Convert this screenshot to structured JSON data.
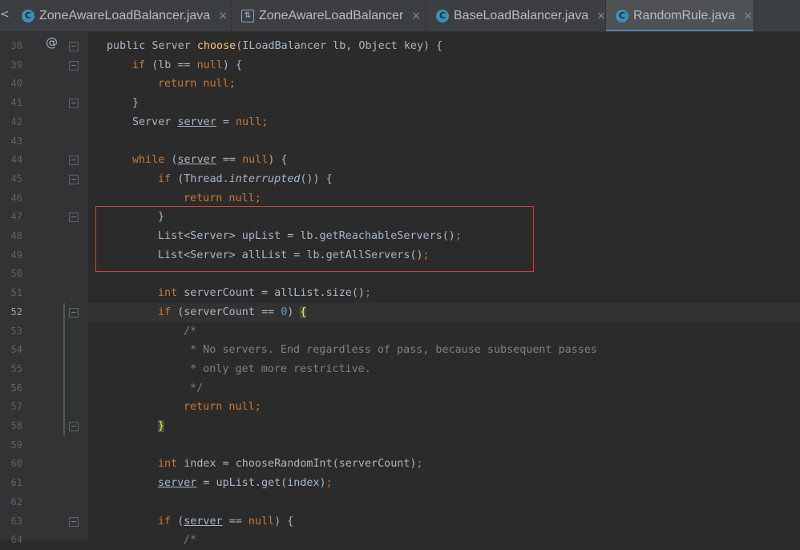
{
  "tabs": [
    {
      "label": "ZoneAwareLoadBalancer.java",
      "icon": "class-icon",
      "active": false
    },
    {
      "label": "ZoneAwareLoadBalancer",
      "icon": "hierarchy-icon",
      "active": false
    },
    {
      "label": "BaseLoadBalancer.java",
      "icon": "class-icon",
      "active": false
    },
    {
      "label": "RandomRule.java",
      "icon": "class-icon",
      "active": true
    }
  ],
  "tab_close_glyph": "×",
  "tab_scroll_glyph": "<",
  "override_marker": "@",
  "current_line": 52,
  "colors": {
    "background": "#2b2b2b",
    "keyword": "#cc7832",
    "method": "#ffc66d",
    "number": "#6897bb",
    "comment": "#808080",
    "highlight_box": "#e03c31"
  },
  "lines": [
    {
      "n": "38",
      "tokens": [
        [
          "",
          "public "
        ],
        [
          "",
          "Server "
        ],
        [
          "fn",
          "choose"
        ],
        [
          "",
          "(ILoadBalancer lb, Object key) {"
        ]
      ]
    },
    {
      "n": "39",
      "tokens": [
        [
          "kw",
          "if "
        ],
        [
          "",
          "(lb == "
        ],
        [
          "kw",
          "null"
        ],
        [
          "",
          ") {"
        ]
      ]
    },
    {
      "n": "40",
      "tokens": [
        [
          "kw",
          "return null"
        ],
        [
          "kw",
          ";"
        ]
      ]
    },
    {
      "n": "41",
      "tokens": [
        [
          "",
          "}"
        ]
      ]
    },
    {
      "n": "42",
      "tokens": [
        [
          "",
          "Server "
        ],
        [
          "ul",
          "server"
        ],
        [
          "",
          " = "
        ],
        [
          "kw",
          "null"
        ],
        [
          "kw",
          ";"
        ]
      ]
    },
    {
      "n": "43",
      "tokens": []
    },
    {
      "n": "44",
      "tokens": [
        [
          "kw",
          "while "
        ],
        [
          "",
          "("
        ],
        [
          "ul",
          "server"
        ],
        [
          "",
          " == "
        ],
        [
          "kw",
          "null"
        ],
        [
          "",
          ") {"
        ]
      ]
    },
    {
      "n": "45",
      "tokens": [
        [
          "kw",
          "if "
        ],
        [
          "",
          "(Thread."
        ],
        [
          "it",
          "interrupted"
        ],
        [
          "",
          "()) {"
        ]
      ]
    },
    {
      "n": "46",
      "tokens": [
        [
          "kw",
          "return null"
        ],
        [
          "kw",
          ";"
        ]
      ]
    },
    {
      "n": "47",
      "tokens": [
        [
          "",
          "}"
        ]
      ]
    },
    {
      "n": "48",
      "tokens": [
        [
          "",
          "List<Server> upList = lb.getReachableServers()"
        ],
        [
          "kw",
          ";"
        ]
      ]
    },
    {
      "n": "49",
      "tokens": [
        [
          "",
          "List<Server> allList = lb.getAllServers()"
        ],
        [
          "kw",
          ";"
        ]
      ]
    },
    {
      "n": "50",
      "tokens": []
    },
    {
      "n": "51",
      "tokens": [
        [
          "kw",
          "int "
        ],
        [
          "",
          "serverCount = allList.size()"
        ],
        [
          "kw",
          ";"
        ]
      ]
    },
    {
      "n": "52",
      "tokens": [
        [
          "kw",
          "if "
        ],
        [
          "",
          "(serverCount == "
        ],
        [
          "num",
          "0"
        ],
        [
          "",
          ") "
        ],
        [
          "bm",
          "{"
        ]
      ]
    },
    {
      "n": "53",
      "tokens": [
        [
          "cm",
          "/*"
        ]
      ]
    },
    {
      "n": "54",
      "tokens": [
        [
          "cm",
          " * No servers. End regardless of pass, because subsequent passes"
        ]
      ]
    },
    {
      "n": "55",
      "tokens": [
        [
          "cm",
          " * only get more restrictive."
        ]
      ]
    },
    {
      "n": "56",
      "tokens": [
        [
          "cm",
          " */"
        ]
      ]
    },
    {
      "n": "57",
      "tokens": [
        [
          "kw",
          "return null"
        ],
        [
          "kw",
          ";"
        ]
      ]
    },
    {
      "n": "58",
      "tokens": [
        [
          "bm",
          "}"
        ]
      ]
    },
    {
      "n": "59",
      "tokens": []
    },
    {
      "n": "60",
      "tokens": [
        [
          "kw",
          "int "
        ],
        [
          "",
          "index = chooseRandomInt(serverCount)"
        ],
        [
          "kw",
          ";"
        ]
      ]
    },
    {
      "n": "61",
      "tokens": [
        [
          "ul",
          "server"
        ],
        [
          "",
          " = upList.get(index)"
        ],
        [
          "kw",
          ";"
        ]
      ]
    },
    {
      "n": "62",
      "tokens": []
    },
    {
      "n": "63",
      "tokens": [
        [
          "kw",
          "if "
        ],
        [
          "",
          "("
        ],
        [
          "ul",
          "server"
        ],
        [
          "",
          " == "
        ],
        [
          "kw",
          "null"
        ],
        [
          "",
          ") {"
        ]
      ]
    },
    {
      "n": "64",
      "tokens": [
        [
          "cm",
          "/*"
        ]
      ]
    }
  ]
}
